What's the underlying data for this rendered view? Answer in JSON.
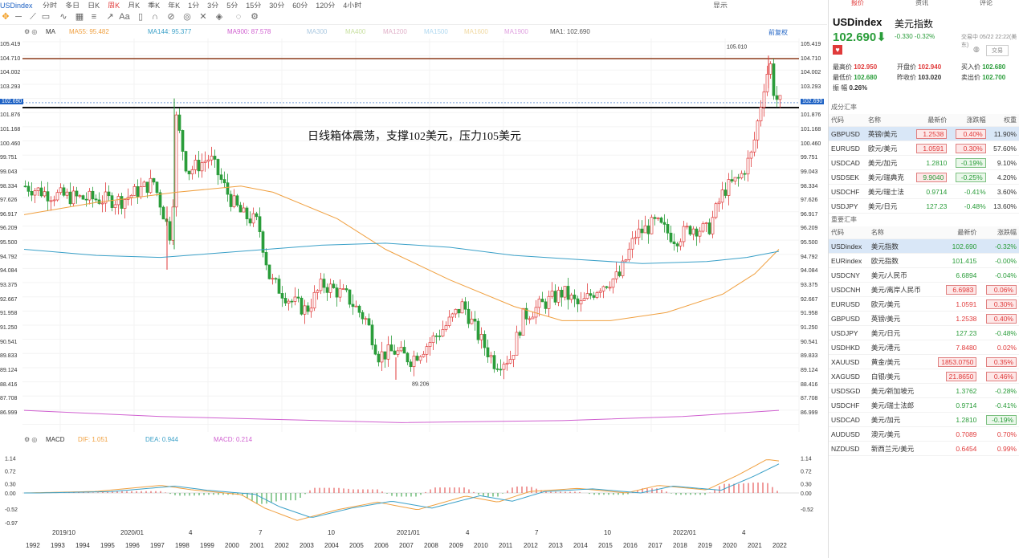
{
  "topbar": {
    "symbol": "USDindex",
    "periods": [
      "分时",
      "多日",
      "日K",
      "周K",
      "月K",
      "季K",
      "年K",
      "1分",
      "3分",
      "5分",
      "15分",
      "30分",
      "60分",
      "120分",
      "4小时"
    ],
    "active_period": "周K",
    "right_label": "显示"
  },
  "legend": {
    "ma": "MA",
    "ma55": "MA55: 95.482",
    "ma144": "MA144: 95.377",
    "ma900": "MA900: 87.578",
    "ma300": "MA300",
    "ma400": "MA400",
    "ma1200": "MA1200",
    "ma1500": "MA1500",
    "ma1600": "MA1600",
    "ma1900": "MA1900",
    "ma1": "MA1: 102.690",
    "fq": "前复权"
  },
  "price_axis": [
    "105.419",
    "104.710",
    "104.002",
    "103.293",
    "102.690",
    "101.876",
    "101.168",
    "100.460",
    "99.751",
    "99.043",
    "98.334",
    "97.626",
    "96.917",
    "96.209",
    "95.500",
    "94.792",
    "94.084",
    "93.375",
    "92.667",
    "91.958",
    "91.250",
    "90.541",
    "89.833",
    "89.124",
    "88.416",
    "87.708",
    "86.999"
  ],
  "current_price_tag": "102.690",
  "high_label": "105.010",
  "low_label": "89.206",
  "annotation": "日线箱体震荡，支撑102美元，压力105美元",
  "macd": {
    "name": "MACD",
    "dif": "DIF: 1.051",
    "dea": "DEA: 0.944",
    "macd": "MACD: 0.214",
    "axis": [
      "1.14",
      "0.72",
      "0.30",
      "0.00",
      "-0.52",
      "-0.97"
    ],
    "axis_right": [
      "1.14",
      "0.72",
      "0.30",
      "0.00",
      "-0.52"
    ]
  },
  "x_months": [
    "2019/10",
    "2020/01",
    "4",
    "7",
    "10",
    "2021/01",
    "4",
    "7",
    "10",
    "2022/01",
    "4"
  ],
  "x_years": [
    "1992",
    "1993",
    "1994",
    "1995",
    "1996",
    "1997",
    "1998",
    "1999",
    "2000",
    "2001",
    "2002",
    "2003",
    "2004",
    "2005",
    "2006",
    "2007",
    "2008",
    "2009",
    "2010",
    "2011",
    "2012",
    "2013",
    "2014",
    "2015",
    "2016",
    "2017",
    "2018",
    "2019",
    "2020",
    "2021",
    "2022"
  ],
  "panel": {
    "tabs": [
      "报价",
      "资讯",
      "评论"
    ],
    "symbol": "USDindex",
    "name": "美元指数",
    "price": "102.690",
    "arrow": "⬇",
    "change": "-0.330",
    "change_pct": "-0.32%",
    "time": "交易中 05/22 22:22(美东)",
    "trade_btn": "交易",
    "stats": {
      "high_l": "最高价",
      "high": "102.950",
      "open_l": "开盘价",
      "open": "102.940",
      "bid_l": "买入价",
      "bid": "102.680",
      "low_l": "最低价",
      "low": "102.680",
      "prev_l": "昨收价",
      "prev": "103.020",
      "ask_l": "卖出价",
      "ask": "102.700",
      "amp_l": "振  幅",
      "amp": "0.26%"
    },
    "section1": "成分汇率",
    "section2": "重要汇率",
    "comp_header": [
      "代码",
      "名称",
      "最新价",
      "涨跌幅",
      "权重"
    ],
    "comp": [
      {
        "code": "GBPUSD",
        "name": "英镑/美元",
        "price": "1.2538",
        "chg": "0.40%",
        "w": "11.90%"
      },
      {
        "code": "EURUSD",
        "name": "欧元/美元",
        "price": "1.0591",
        "chg": "0.30%",
        "w": "57.60%"
      },
      {
        "code": "USDCAD",
        "name": "美元/加元",
        "price": "1.2810",
        "chg": "-0.19%",
        "w": "9.10%"
      },
      {
        "code": "USDSEK",
        "name": "美元/瑞典克",
        "price": "9.9040",
        "chg": "-0.25%",
        "w": "4.20%"
      },
      {
        "code": "USDCHF",
        "name": "美元/瑞士法",
        "price": "0.9714",
        "chg": "-0.41%",
        "w": "3.60%"
      },
      {
        "code": "USDJPY",
        "name": "美元/日元",
        "price": "127.23",
        "chg": "-0.48%",
        "w": "13.60%"
      }
    ],
    "imp_header": [
      "代码",
      "名称",
      "最新价",
      "涨跌幅"
    ],
    "imp": [
      {
        "code": "USDindex",
        "name": "美元指数",
        "price": "102.690",
        "chg": "-0.32%"
      },
      {
        "code": "EURindex",
        "name": "欧元指数",
        "price": "101.415",
        "chg": "-0.00%"
      },
      {
        "code": "USDCNY",
        "name": "美元/人民币",
        "price": "6.6894",
        "chg": "-0.04%"
      },
      {
        "code": "USDCNH",
        "name": "美元/离岸人民币",
        "price": "6.6983",
        "chg": "0.06%"
      },
      {
        "code": "EURUSD",
        "name": "欧元/美元",
        "price": "1.0591",
        "chg": "0.30%"
      },
      {
        "code": "GBPUSD",
        "name": "英镑/美元",
        "price": "1.2538",
        "chg": "0.40%"
      },
      {
        "code": "USDJPY",
        "name": "美元/日元",
        "price": "127.23",
        "chg": "-0.48%"
      },
      {
        "code": "USDHKD",
        "name": "美元/港元",
        "price": "7.8480",
        "chg": "0.02%"
      },
      {
        "code": "XAUUSD",
        "name": "黄金/美元",
        "price": "1853.0750",
        "chg": "0.35%"
      },
      {
        "code": "XAGUSD",
        "name": "白银/美元",
        "price": "21.8650",
        "chg": "0.46%"
      },
      {
        "code": "USDSGD",
        "name": "美元/新加坡元",
        "price": "1.3762",
        "chg": "-0.28%"
      },
      {
        "code": "USDCHF",
        "name": "美元/瑞士法郎",
        "price": "0.9714",
        "chg": "-0.41%"
      },
      {
        "code": "USDCAD",
        "name": "美元/加元",
        "price": "1.2810",
        "chg": "-0.19%"
      },
      {
        "code": "AUDUSD",
        "name": "澳元/美元",
        "price": "0.7089",
        "chg": "0.70%"
      },
      {
        "code": "NZDUSD",
        "name": "新西兰元/美元",
        "price": "0.6454",
        "chg": "0.99%"
      }
    ]
  },
  "colors": {
    "up": "#e03a3a",
    "down": "#2a9d3a",
    "ma55": "#f0a040",
    "ma144": "#3aa0c8",
    "ma900": "#d060d0",
    "accent": "#1e62c4"
  }
}
